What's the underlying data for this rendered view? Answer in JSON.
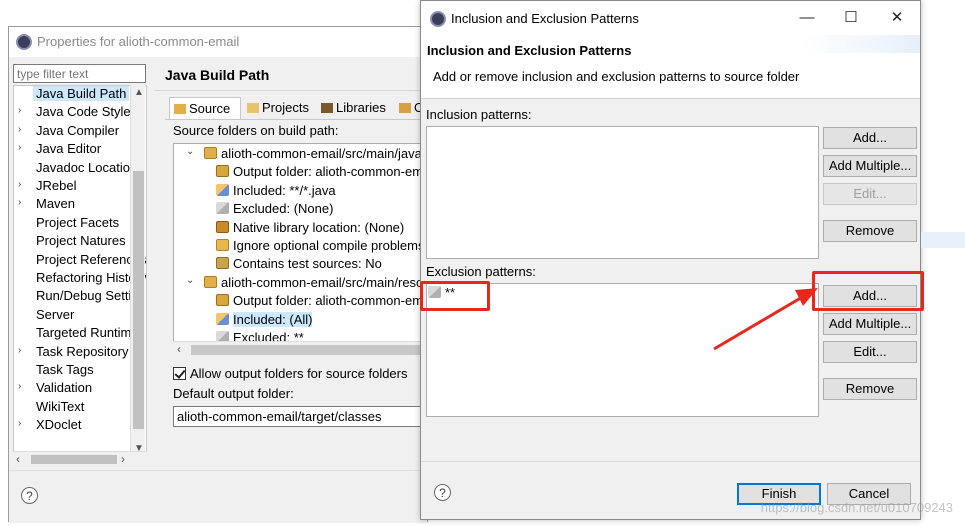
{
  "properties_window": {
    "title": "Properties for alioth-common-email",
    "filter_placeholder": "type filter text",
    "tree_items": [
      {
        "label": "Java Build Path",
        "arrow": "",
        "selected": true
      },
      {
        "label": "Java Code Style",
        "arrow": "›"
      },
      {
        "label": "Java Compiler",
        "arrow": "›"
      },
      {
        "label": "Java Editor",
        "arrow": "›"
      },
      {
        "label": "Javadoc Location",
        "arrow": ""
      },
      {
        "label": "JRebel",
        "arrow": "›"
      },
      {
        "label": "Maven",
        "arrow": "›"
      },
      {
        "label": "Project Facets",
        "arrow": ""
      },
      {
        "label": "Project Natures",
        "arrow": ""
      },
      {
        "label": "Project References",
        "arrow": ""
      },
      {
        "label": "Refactoring History",
        "arrow": ""
      },
      {
        "label": "Run/Debug Settings",
        "arrow": ""
      },
      {
        "label": "Server",
        "arrow": ""
      },
      {
        "label": "Targeted Runtimes",
        "arrow": ""
      },
      {
        "label": "Task Repository",
        "arrow": "›"
      },
      {
        "label": "Task Tags",
        "arrow": ""
      },
      {
        "label": "Validation",
        "arrow": "›"
      },
      {
        "label": "WikiText",
        "arrow": ""
      },
      {
        "label": "XDoclet",
        "arrow": "›"
      }
    ],
    "page_title": "Java Build Path",
    "tabs": [
      {
        "label": "Source"
      },
      {
        "label": "Projects"
      },
      {
        "label": "Libraries"
      },
      {
        "label": "Or"
      }
    ],
    "source_folders_label": "Source folders on build path:",
    "source_tree": [
      {
        "text": "alioth-common-email/src/main/java",
        "level": 0,
        "chev": "⌄",
        "icon": "folder"
      },
      {
        "text": "Output folder: alioth-common-email",
        "level": 1,
        "icon": "out"
      },
      {
        "text": "Included: **/*.java",
        "level": 1,
        "icon": "incl"
      },
      {
        "text": "Excluded: (None)",
        "level": 1,
        "icon": "excl"
      },
      {
        "text": "Native library location: (None)",
        "level": 1,
        "icon": "native"
      },
      {
        "text": "Ignore optional compile problems",
        "level": 1,
        "icon": "warn"
      },
      {
        "text": "Contains test sources: No",
        "level": 1,
        "icon": "test"
      },
      {
        "text": "alioth-common-email/src/main/resources",
        "level": 0,
        "chev": "⌄",
        "icon": "folder"
      },
      {
        "text": "Output folder: alioth-common-email",
        "level": 1,
        "icon": "out"
      },
      {
        "text": "Included: (All)",
        "level": 1,
        "icon": "incl",
        "selected": true
      },
      {
        "text": "Excluded: **",
        "level": 1,
        "icon": "excl"
      }
    ],
    "allow_output_label": "Allow output folders for source folders",
    "default_output_label": "Default output folder:",
    "default_output_value": "alioth-common-email/target/classes",
    "help": "?"
  },
  "dialog": {
    "title": "Inclusion and Exclusion Patterns",
    "header_title": "Inclusion and Exclusion Patterns",
    "header_desc": "Add or remove inclusion and exclusion patterns to source folder",
    "minimize": "—",
    "maximize": "☐",
    "close": "✕",
    "inclusion_label": "Inclusion patterns:",
    "inclusion_buttons": {
      "add": "Add...",
      "add_multiple": "Add Multiple...",
      "edit": "Edit...",
      "remove": "Remove"
    },
    "exclusion_label": "Exclusion patterns:",
    "exclusion_items": [
      "**"
    ],
    "exclusion_buttons": {
      "add": "Add...",
      "add_multiple": "Add Multiple...",
      "edit": "Edit...",
      "remove": "Remove"
    },
    "finish": "Finish",
    "cancel": "Cancel",
    "help": "?"
  },
  "watermark": "https://blog.csdn.net/u010709243",
  "annotation_color": "#e8281c"
}
